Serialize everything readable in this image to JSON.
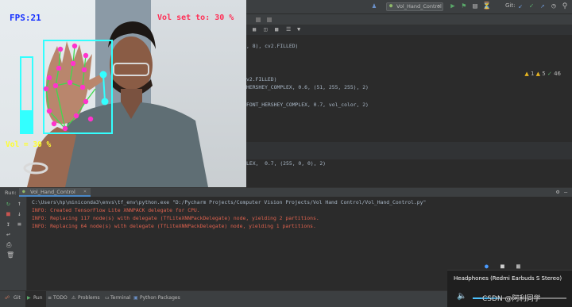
{
  "toolbar": {
    "config_name": "Vol_Hand_Control",
    "git_label": "Git:"
  },
  "inspections": {
    "warnings": "1",
    "weak_warnings": "5",
    "typos": "46"
  },
  "editor": {
    "lines": [
      ", 8), cv2.FILLED)",
      "v2.FILLED)",
      "HERSHEY_COMPLEX, 0.6, (51, 255, 255), 2)",
      "FONT_HERSHEY_COMPLEX, 0.7, vol_color, 2)",
      "LEX,  0.7, (255, 0, 0), 2)"
    ]
  },
  "camera": {
    "fps_text": "FPS:21",
    "vol_set_text": "Vol set to: 30 %",
    "vol_text": "Vol = 30 %",
    "volume_level": 0.3,
    "hud_color_fps": "#1530ff",
    "hud_color_vol": "#ff2e55",
    "hud_color_yellow": "#ffff2e",
    "bar_color": "#33ffff"
  },
  "run": {
    "tab_label": "Run:",
    "config_name": "Vol_Hand_Control",
    "console": [
      {
        "text": "C:\\Users\\hp\\miniconda3\\envs\\tf_env\\python.exe \"D:/Pycharm Projects/Computer Vision Projects/Vol Hand Control/Vol_Hand_Control.py\"",
        "color": "#a9b7c6"
      },
      {
        "text": "INFO: Created TensorFlow Lite XNNPACK delegate for CPU.",
        "color": "#e0624e"
      },
      {
        "text": "INFO: Replacing 117 node(s) with delegate (TfLiteXNNPackDelegate) node, yielding 2 partitions.",
        "color": "#e0624e"
      },
      {
        "text": "INFO: Replacing 64 node(s) with delegate (TfLiteXNNPackDelegate) node, yielding 1 partitions.",
        "color": "#e0624e"
      }
    ]
  },
  "statusbar": {
    "git": "Git",
    "run": "Run",
    "todo": "TODO",
    "problems": "Problems",
    "terminal": "Terminal",
    "python_packages": "Python Packages"
  },
  "volume_flyout": {
    "device": "Headphones (Redmi Earbuds S Stereo)",
    "watermark": "CSDN @阿利同学"
  }
}
